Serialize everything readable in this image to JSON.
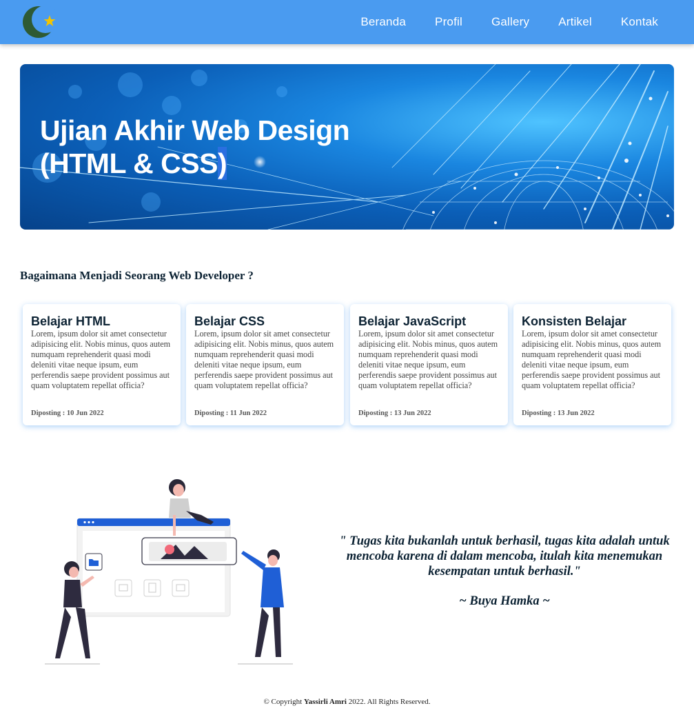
{
  "nav": {
    "logo_icon": "crescent-star-icon",
    "items": [
      "Beranda",
      "Profil",
      "Gallery",
      "Artikel",
      "Kontak"
    ]
  },
  "hero": {
    "title_line1": "Ujian Akhir Web Design",
    "title_line2_main": "(HTML & CSS",
    "title_line2_end": ")"
  },
  "section": {
    "title": "Bagaimana Menjadi Seorang Web Developer ?"
  },
  "cards": [
    {
      "title": "Belajar HTML",
      "body": "Lorem, ipsum dolor sit amet consectetur adipisicing elit. Nobis minus, quos autem numquam reprehenderit quasi modi deleniti vitae neque ipsum, eum perferendis saepe provident possimus aut quam voluptatem repellat officia?",
      "date": "Diposting : 10 Jun 2022"
    },
    {
      "title": "Belajar CSS",
      "body": "Lorem, ipsum dolor sit amet consectetur adipisicing elit. Nobis minus, quos autem numquam reprehenderit quasi modi deleniti vitae neque ipsum, eum perferendis saepe provident possimus aut quam voluptatem repellat officia?",
      "date": "Diposting : 11 Jun 2022"
    },
    {
      "title": "Belajar JavaScript",
      "body": "Lorem, ipsum dolor sit amet consectetur adipisicing elit. Nobis minus, quos autem numquam reprehenderit quasi modi deleniti vitae neque ipsum, eum perferendis saepe provident possimus aut quam voluptatem repellat officia?",
      "date": "Diposting : 13 Jun 2022"
    },
    {
      "title": "Konsisten Belajar",
      "body": "Lorem, ipsum dolor sit amet consectetur adipisicing elit. Nobis minus, quos autem numquam reprehenderit quasi modi deleniti vitae neque ipsum, eum perferendis saepe provident possimus aut quam voluptatem repellat officia?",
      "date": "Diposting : 13 Jun 2022"
    }
  ],
  "quote": {
    "text": "\" Tugas kita bukanlah untuk berhasil, tugas kita adalah untuk mencoba karena di dalam mencoba, itulah kita menemukan kesempatan untuk berhasil.\"",
    "author": "~ Buya Hamka ~"
  },
  "footer": {
    "prefix": "© Copyright ",
    "name": "Yassirli Amri",
    "suffix": " 2022. All Rights Reserved."
  },
  "colors": {
    "navbar": "#4a9bf0",
    "text_dark": "#0c2233",
    "accent_blue": "#1f5fd6",
    "logo_moon": "#2e5a34",
    "logo_star": "#f3c400"
  }
}
